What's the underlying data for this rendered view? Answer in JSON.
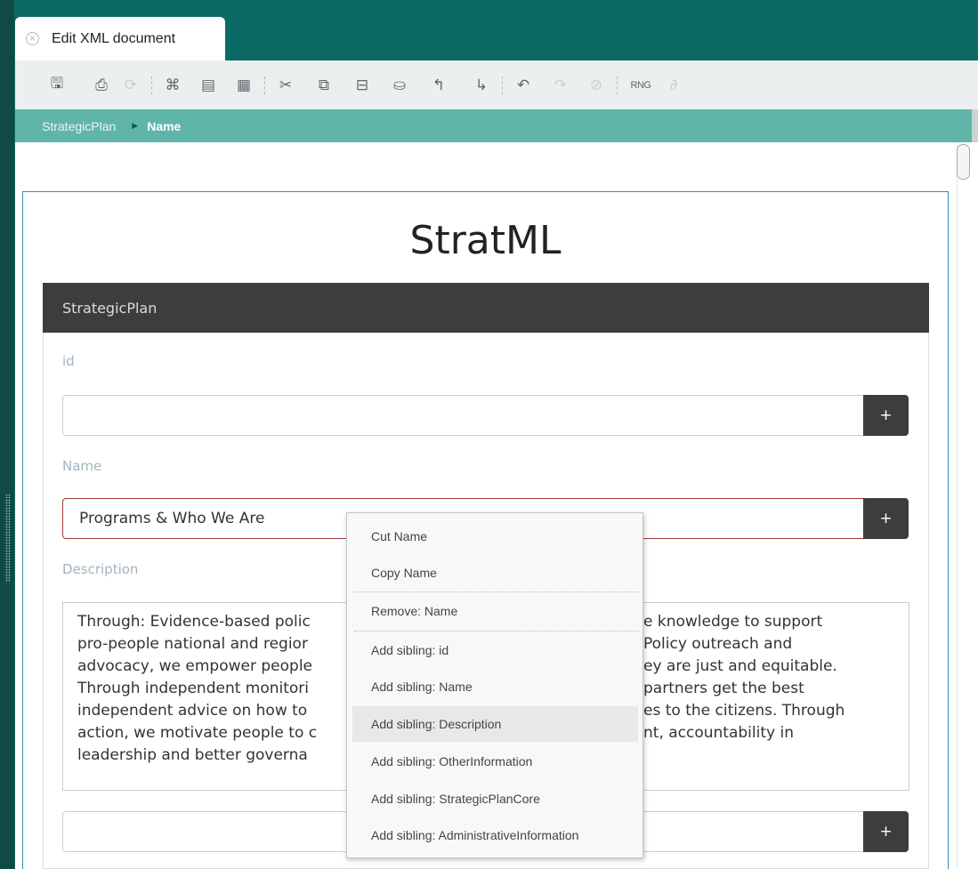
{
  "window": {
    "tab_title": "Edit XML document",
    "tab_close_icon": "close-circle-icon"
  },
  "toolbar": {
    "buttons": [
      {
        "icon": "save-icon",
        "glyph": "🖫",
        "enabled": true
      },
      {
        "icon": "preview-icon",
        "glyph": "⎙",
        "enabled": true
      },
      {
        "icon": "refresh-icon",
        "glyph": "⟳",
        "enabled": false
      },
      {
        "icon": "tree-view-icon",
        "glyph": "⌘",
        "enabled": true
      },
      {
        "icon": "form-view-icon",
        "glyph": "▤",
        "enabled": true
      },
      {
        "icon": "text-view-icon",
        "glyph": "▦",
        "enabled": true
      },
      {
        "icon": "cut-icon",
        "glyph": "✂",
        "enabled": true
      },
      {
        "icon": "copy-icon",
        "glyph": "⧉",
        "enabled": true
      },
      {
        "icon": "paste-icon",
        "glyph": "📋",
        "enabled": true
      },
      {
        "icon": "delete-icon",
        "glyph": "🗑",
        "enabled": true
      },
      {
        "icon": "move-up-icon",
        "glyph": "⤴",
        "enabled": true
      },
      {
        "icon": "move-down-icon",
        "glyph": "⤵",
        "enabled": true
      },
      {
        "icon": "undo-icon",
        "glyph": "↶",
        "enabled": true
      },
      {
        "icon": "redo-icon",
        "glyph": "↷",
        "enabled": false
      },
      {
        "icon": "clear-icon",
        "glyph": "⊘",
        "enabled": false
      },
      {
        "icon": "validate-rng-icon",
        "glyph": "RNG",
        "enabled": true
      },
      {
        "icon": "link-icon",
        "glyph": "∂",
        "enabled": false
      }
    ]
  },
  "breadcrumb": {
    "root": "StrategicPlan",
    "current": "Name"
  },
  "document": {
    "title": "StratML",
    "section_title": "StrategicPlan",
    "fields": {
      "id": {
        "label": "id",
        "value": ""
      },
      "name": {
        "label": "Name",
        "value": "Programs & Who We Are"
      },
      "description": {
        "label": "Description",
        "lines": [
          "Through: Evidence-based polic",
          "pro-people national and regior",
          "advocacy, we empower people",
          "Through independent monitori",
          "independent advice on how to",
          "action, we motivate people to c",
          "leadership and better governa"
        ],
        "lines_right": [
          "e knowledge to support",
          "Policy outreach and",
          "ey are just and equitable.",
          "partners get the best",
          "es to the citizens. Through",
          "nt, accountability in",
          ""
        ]
      },
      "other": {
        "value": ""
      }
    },
    "add_button_label": "+"
  },
  "context_menu": {
    "items": [
      {
        "label": "Cut Name"
      },
      {
        "label": "Copy Name"
      },
      {
        "label": "Remove: Name"
      },
      {
        "label": "Add sibling: id"
      },
      {
        "label": "Add sibling: Name"
      },
      {
        "label": "Add sibling: Description",
        "highlighted": true
      },
      {
        "label": "Add sibling: OtherInformation"
      },
      {
        "label": "Add sibling: StrategicPlanCore"
      },
      {
        "label": "Add sibling: AdministrativeInformation"
      }
    ]
  }
}
